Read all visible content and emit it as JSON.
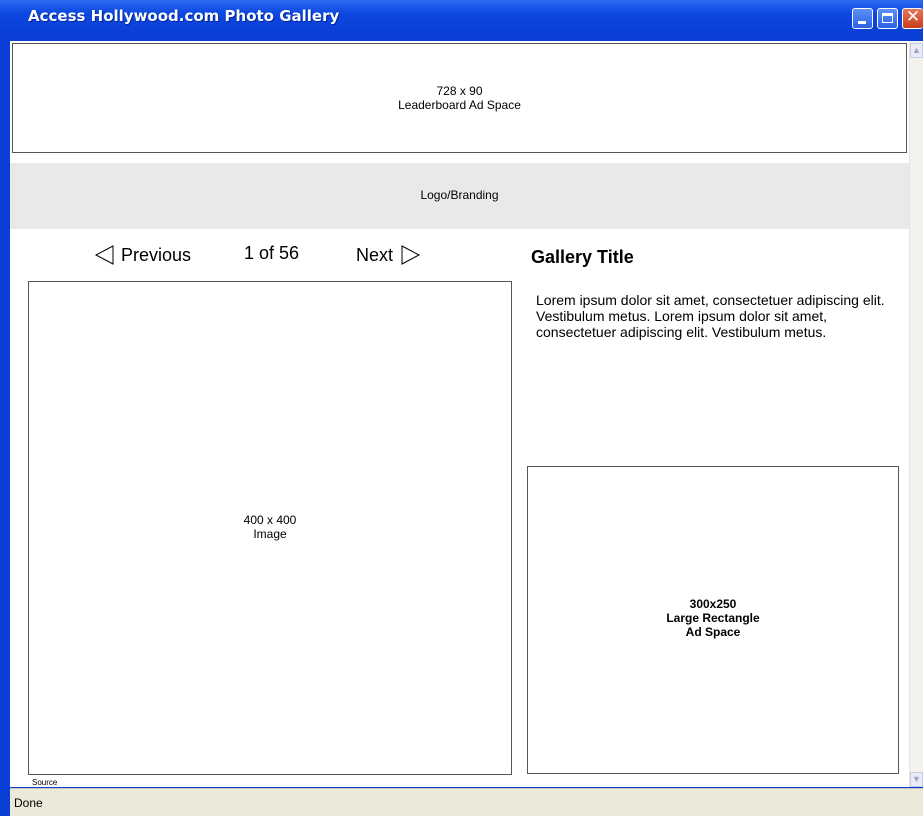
{
  "window": {
    "title": "Access Hollywood.com Photo Gallery",
    "status": "Done",
    "controls": [
      "minimize",
      "maximize",
      "close"
    ],
    "close_glyph": "✕"
  },
  "leaderboard": {
    "size": "728 x 90",
    "label": "Leaderboard Ad Space"
  },
  "branding": {
    "label": "Logo/Branding"
  },
  "pager": {
    "previous": "Previous",
    "count": "1 of 56",
    "next": "Next"
  },
  "image": {
    "size": "400 x 400",
    "label": "Image",
    "source": "Source"
  },
  "gallery": {
    "title": "Gallery Title",
    "description": "Lorem ipsum dolor sit amet, consectetuer adipiscing elit. Vestibulum metus.  Lorem ipsum dolor sit amet, consectetuer adipiscing elit. Vestibulum metus."
  },
  "rectangle_ad": {
    "size": "300x250",
    "label1": "Large Rectangle",
    "label2": "Ad Space"
  },
  "colors": {
    "titlebar": "#0a3fd6",
    "branding_bg": "#e9e9e9",
    "statusbar": "#ece9d8"
  }
}
